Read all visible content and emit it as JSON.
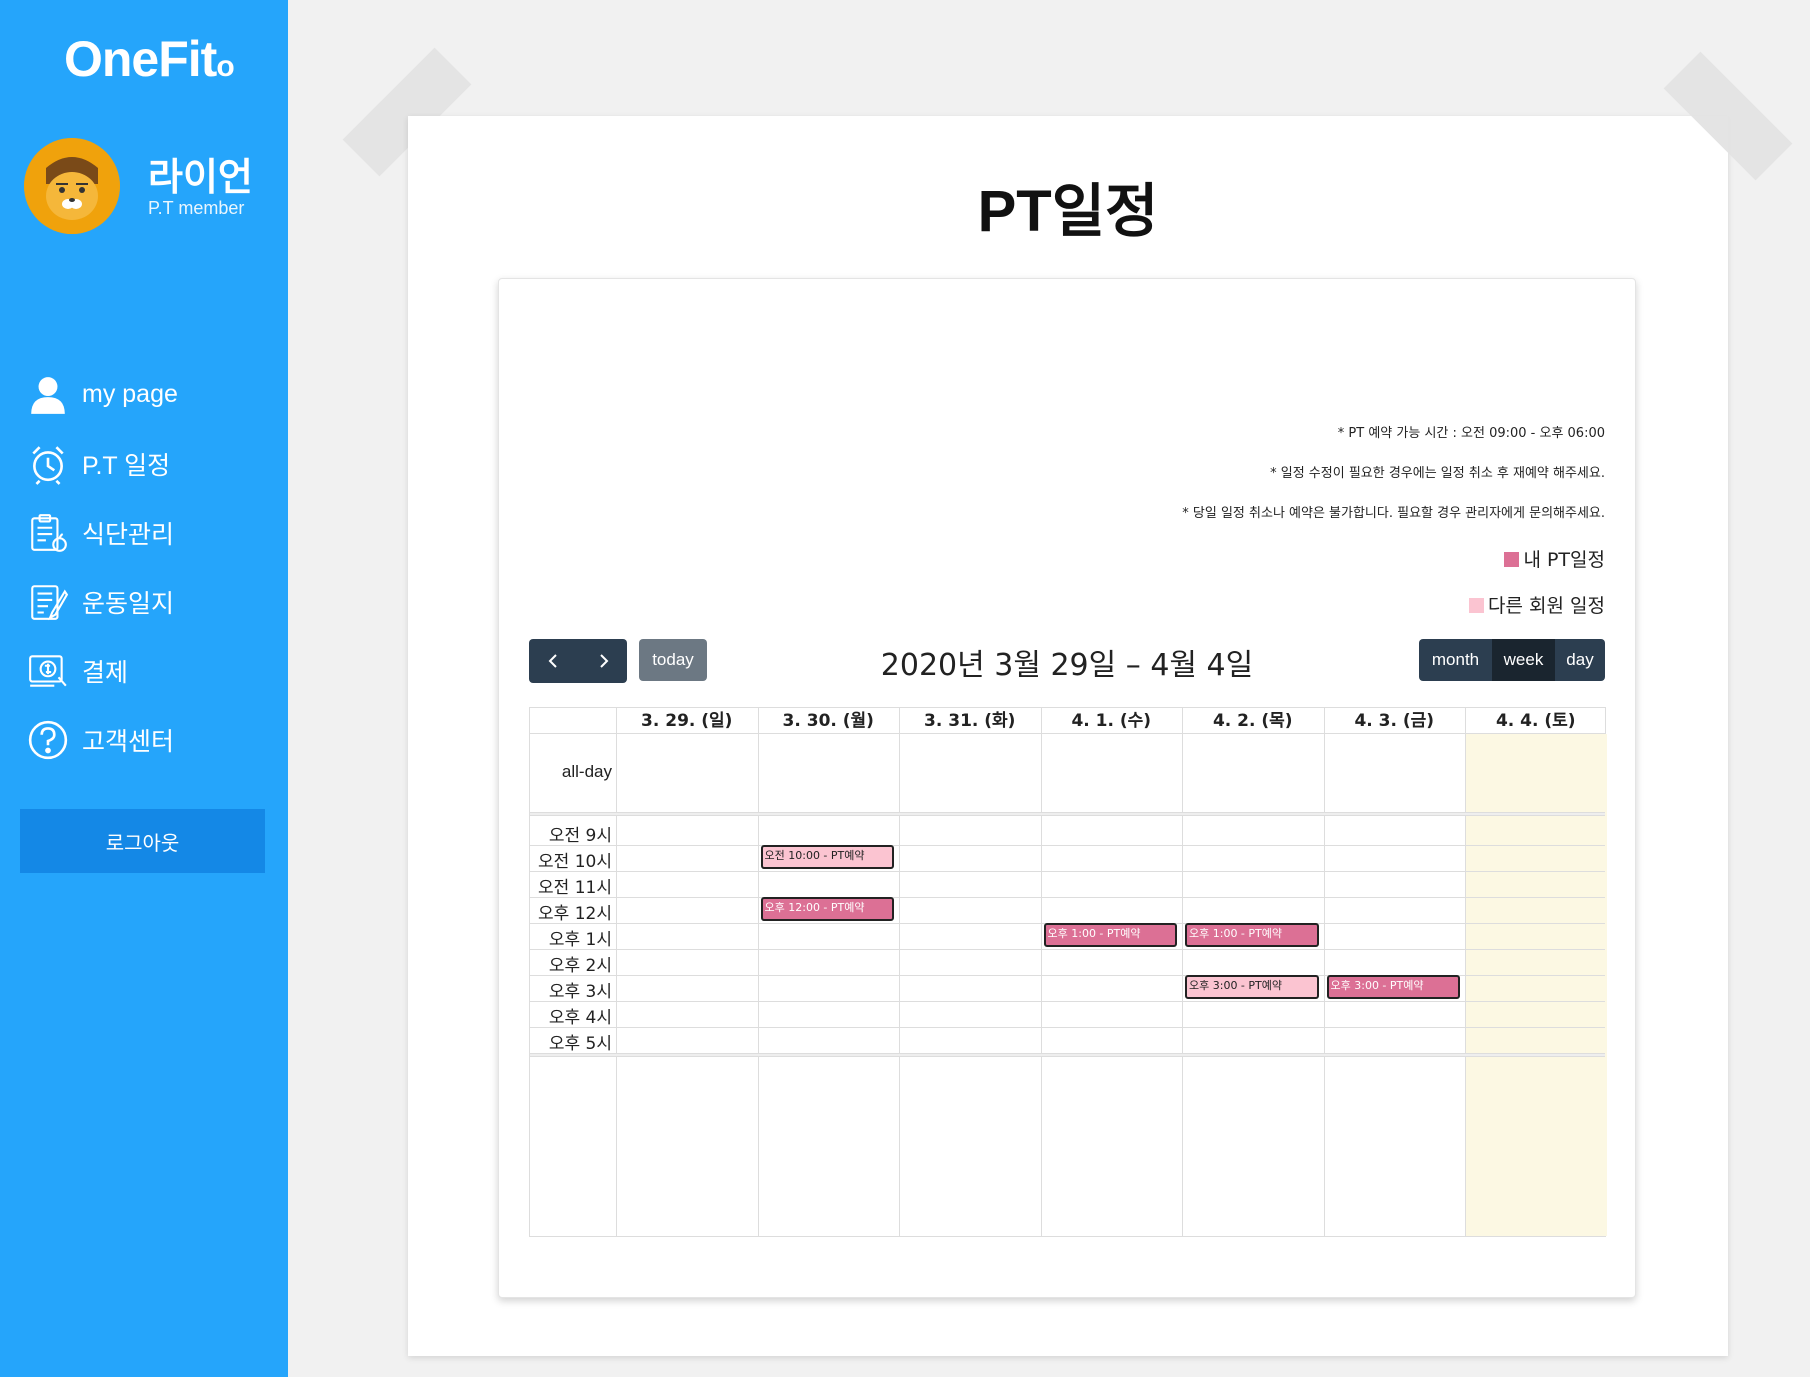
{
  "app": {
    "logo": "OneFit",
    "logo_dot": "o"
  },
  "user": {
    "name": "라이언",
    "role": "P.T member"
  },
  "nav": [
    {
      "label": "my page",
      "icon": "person-icon"
    },
    {
      "label": "P.T 일정",
      "icon": "alarm-clock-icon"
    },
    {
      "label": "식단관리",
      "icon": "clipboard-apple-icon"
    },
    {
      "label": "운동일지",
      "icon": "document-pen-icon"
    },
    {
      "label": "결제",
      "icon": "payment-icon"
    },
    {
      "label": "고객센터",
      "icon": "help-icon"
    }
  ],
  "logout_label": "로그아웃",
  "page_title": "PT일정",
  "notes": [
    "* PT 예약 가능 시간 : 오전 09:00 - 오후 06:00",
    "* 일정 수정이 필요한 경우에는 일정 취소 후 재예약 해주세요.",
    "* 당일 일정 취소나 예약은 불가합니다. 필요할 경우 관리자에게 문의해주세요."
  ],
  "legend": {
    "mine": {
      "label": "내 PT일정",
      "color": "#dc7095"
    },
    "other": {
      "label": "다른 회원 일정",
      "color": "#fbc4d1"
    }
  },
  "calendar": {
    "today_label": "today",
    "title": "2020년 3월 29일 – 4월 4일",
    "views": {
      "month": "month",
      "week": "week",
      "day": "day",
      "active": "week"
    },
    "columns": [
      "3. 29. (일)",
      "3. 30. (월)",
      "3. 31. (화)",
      "4. 1. (수)",
      "4. 2. (목)",
      "4. 3. (금)",
      "4. 4. (토)"
    ],
    "allday_label": "all-day",
    "hours": [
      "오전 9시",
      "오전 10시",
      "오전 11시",
      "오후 12시",
      "오후 1시",
      "오후 2시",
      "오후 3시",
      "오후 4시",
      "오후 5시"
    ],
    "events": [
      {
        "day": 1,
        "hour": 1,
        "text": "오전 10:00 - PT예약",
        "kind": "other"
      },
      {
        "day": 1,
        "hour": 3,
        "text": "오후 12:00 - PT예약",
        "kind": "mine"
      },
      {
        "day": 3,
        "hour": 4,
        "text": "오후 1:00 - PT예약",
        "kind": "mine"
      },
      {
        "day": 4,
        "hour": 4,
        "text": "오후 1:00 - PT예약",
        "kind": "mine"
      },
      {
        "day": 4,
        "hour": 6,
        "text": "오후 3:00 - PT예약",
        "kind": "other"
      },
      {
        "day": 5,
        "hour": 6,
        "text": "오후 3:00 - PT예약",
        "kind": "mine"
      }
    ]
  }
}
